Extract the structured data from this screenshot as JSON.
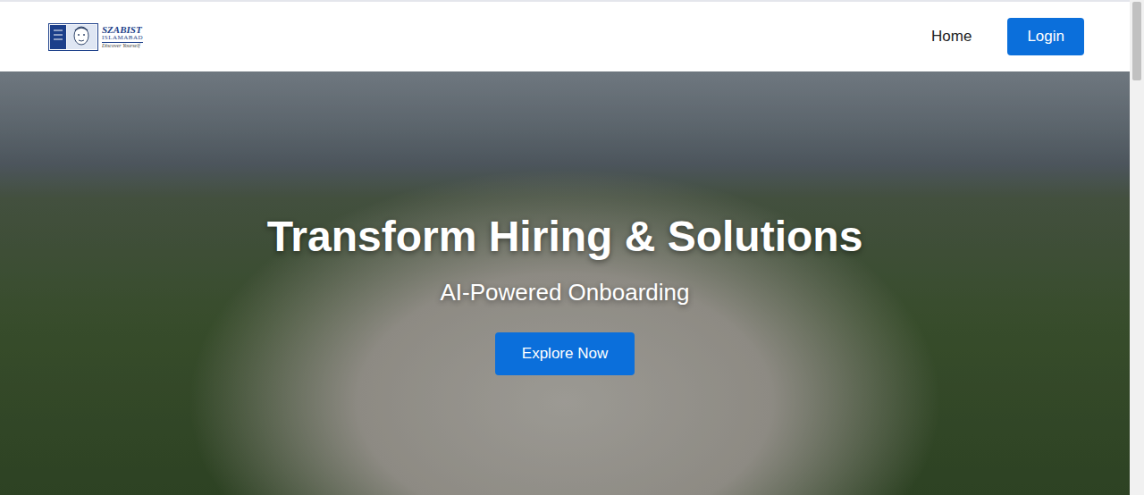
{
  "logo": {
    "name": "SZABIST",
    "campus": "ISLAMABAD",
    "tagline": "Discover Yourself"
  },
  "nav": {
    "links": [
      {
        "label": "Home"
      }
    ],
    "login": "Login"
  },
  "hero": {
    "title": "Transform Hiring & Solutions",
    "subtitle": "AI-Powered Onboarding",
    "button": "Explore Now"
  }
}
